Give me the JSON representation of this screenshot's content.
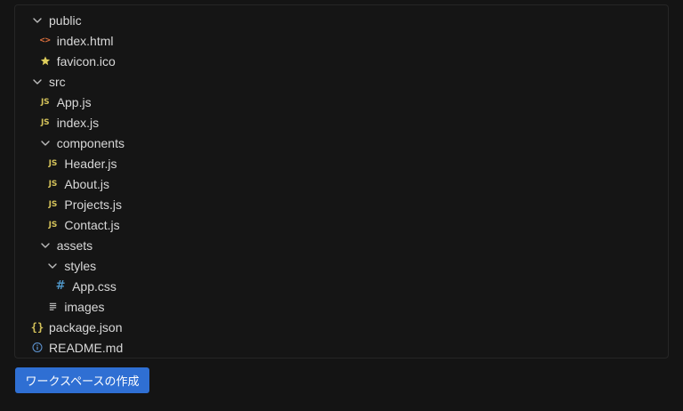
{
  "tree": [
    {
      "label": "public",
      "type": "folder",
      "depth": 0,
      "expanded": true,
      "icon": "chevron-down-icon"
    },
    {
      "label": "index.html",
      "type": "html",
      "depth": 1,
      "icon": "html-file-icon"
    },
    {
      "label": "favicon.ico",
      "type": "ico",
      "depth": 1,
      "icon": "star-icon"
    },
    {
      "label": "src",
      "type": "folder",
      "depth": 0,
      "expanded": true,
      "icon": "chevron-down-icon"
    },
    {
      "label": "App.js",
      "type": "js",
      "depth": 1,
      "icon": "js-file-icon"
    },
    {
      "label": "index.js",
      "type": "js",
      "depth": 1,
      "icon": "js-file-icon"
    },
    {
      "label": "components",
      "type": "folder",
      "depth": 1,
      "expanded": true,
      "icon": "chevron-down-icon"
    },
    {
      "label": "Header.js",
      "type": "js",
      "depth": 2,
      "icon": "js-file-icon"
    },
    {
      "label": "About.js",
      "type": "js",
      "depth": 2,
      "icon": "js-file-icon"
    },
    {
      "label": "Projects.js",
      "type": "js",
      "depth": 2,
      "icon": "js-file-icon"
    },
    {
      "label": "Contact.js",
      "type": "js",
      "depth": 2,
      "icon": "js-file-icon"
    },
    {
      "label": "assets",
      "type": "folder",
      "depth": 1,
      "expanded": true,
      "icon": "chevron-down-icon"
    },
    {
      "label": "styles",
      "type": "folder",
      "depth": 2,
      "expanded": true,
      "icon": "chevron-down-icon"
    },
    {
      "label": "App.css",
      "type": "css",
      "depth": 3,
      "icon": "hash-icon"
    },
    {
      "label": "images",
      "type": "list",
      "depth": 2,
      "icon": "lines-icon"
    },
    {
      "label": "package.json",
      "type": "json",
      "depth": 0,
      "icon": "json-braces-icon"
    },
    {
      "label": "README.md",
      "type": "info",
      "depth": 0,
      "icon": "info-icon"
    }
  ],
  "create_button": {
    "label": "ワークスペースの作成"
  },
  "colors": {
    "background": "#141414",
    "text": "#d8d8d8",
    "js": "#d4c25a",
    "html": "#d76d3c",
    "css": "#4f97c9",
    "button": "#2f6fd3"
  }
}
